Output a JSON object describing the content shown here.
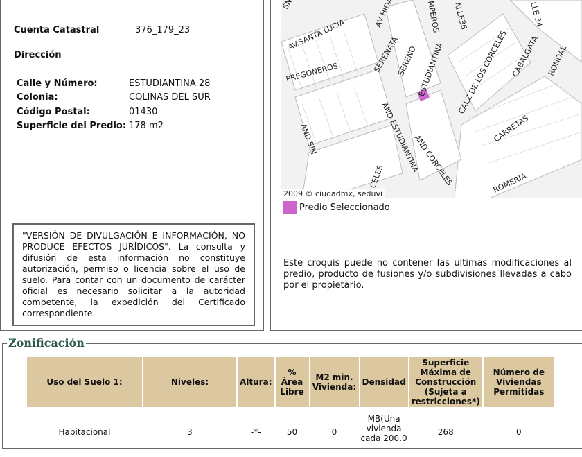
{
  "info": {
    "cuenta_label": "Cuenta Catastral",
    "cuenta_value": "376_179_23",
    "direccion_label": "Dirección",
    "fields": [
      {
        "label": "Calle y Número:",
        "value": "ESTUDIANTINA 28"
      },
      {
        "label": "Colonia:",
        "value": "COLINAS DEL SUR"
      },
      {
        "label": "Código Postal:",
        "value": "01430"
      },
      {
        "label": "Superficie del Predio:",
        "value": "178 m2"
      }
    ]
  },
  "disclaimer": "\"VERSIÓN DE DIVULGACIÓN E INFORMACIÓN, NO PRODUCE EFECTOS JURÍDICOS\". La consulta y difusión de esta información no constituye autorización, permiso o licencia sobre el uso de suelo. Para contar con un documento de carácter oficial es necesario solicitar a la autoridad competente, la expedición del Certificado correspondiente.",
  "map": {
    "streets": [
      "SN",
      "AV HIDA",
      "AV.SANTA LUCIA",
      "MPEROS",
      "ALLE36",
      "LLE 34",
      "CALZ DE LOS CORCELES",
      "CABALGATA",
      "RONDAL",
      "PREGONEROS",
      "SERENATA",
      "SERENO",
      "ESTUDIANTINA",
      "AND SIN",
      "AND ESTUDIANTINA",
      "AND CORCELES",
      "CARRETAS",
      "ROMERIA",
      "CELES"
    ],
    "copyright": "2009 © ciudadmx, seduvi",
    "highlight_color": "#cc66cc"
  },
  "legend": {
    "label": "Predio Seleccionado"
  },
  "note": "Este croquis puede no contener las ultimas modificaciones al predio, producto de fusiones y/o subdivisiones llevadas a cabo por el propietario.",
  "zonificacion": {
    "title": "Zonificación",
    "headers": [
      "Uso del Suelo 1:",
      "Niveles:",
      "Altura:",
      "% Área Libre",
      "M2 min. Vivienda:",
      "Densidad",
      "Superficie Máxima de Construcción (Sujeta a restricciones*)",
      "Número de Viviendas Permitidas"
    ],
    "row": [
      "Habitacional",
      "3",
      "-*-",
      "50",
      "0",
      "MB(Una vivienda cada 200.0",
      "268",
      "0"
    ]
  }
}
